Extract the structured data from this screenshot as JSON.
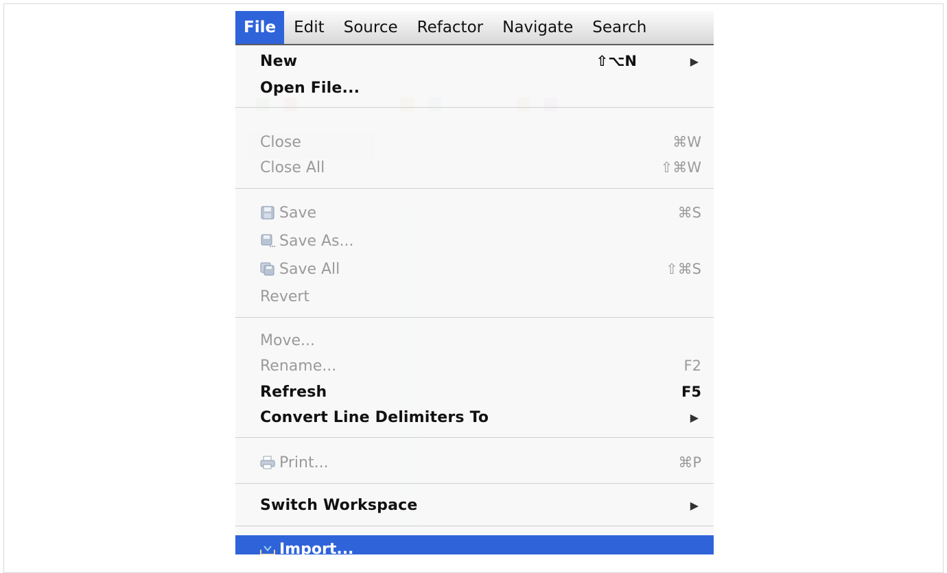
{
  "menubar": {
    "items": [
      "File",
      "Edit",
      "Source",
      "Refactor",
      "Navigate",
      "Search"
    ],
    "active": "File"
  },
  "menu": {
    "new": {
      "label": "New",
      "shortcut": "⇧⌥N",
      "submenu": "▶"
    },
    "open_file": {
      "label": "Open File..."
    },
    "close": {
      "label": "Close",
      "shortcut": "⌘W"
    },
    "close_all": {
      "label": "Close All",
      "shortcut": "⇧⌘W"
    },
    "save": {
      "label": "Save",
      "shortcut": "⌘S",
      "icon": "save-icon"
    },
    "save_as": {
      "label": "Save As...",
      "icon": "save-as-icon"
    },
    "save_all": {
      "label": "Save All",
      "shortcut": "⇧⌘S",
      "icon": "save-all-icon"
    },
    "revert": {
      "label": "Revert"
    },
    "move": {
      "label": "Move..."
    },
    "rename": {
      "label": "Rename...",
      "shortcut": "F2"
    },
    "refresh": {
      "label": "Refresh",
      "shortcut": "F5"
    },
    "convert": {
      "label": "Convert Line Delimiters To",
      "submenu": "▶"
    },
    "print": {
      "label": "Print...",
      "shortcut": "⌘P",
      "icon": "print-icon"
    },
    "switch_workspace": {
      "label": "Switch Workspace",
      "submenu": "▶"
    },
    "import": {
      "label": "Import...",
      "icon": "import-icon"
    }
  },
  "colors": {
    "highlight": "#2f63d9",
    "disabled_text": "#9a9a9a"
  }
}
